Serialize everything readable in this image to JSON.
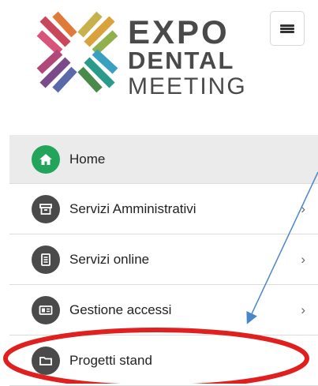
{
  "logo": {
    "line1": "EXPO",
    "line2": "DENTAL",
    "line3": "MEETING"
  },
  "menu_button": {
    "icon": "hamburger-menu-icon"
  },
  "menu": {
    "items": [
      {
        "label": "Home",
        "icon": "home-icon",
        "has_submenu": false,
        "active": true
      },
      {
        "label": "Servizi Amministrativi",
        "icon": "archive-box-icon",
        "has_submenu": true,
        "chevron": "›"
      },
      {
        "label": "Servizi online",
        "icon": "document-icon",
        "has_submenu": true,
        "chevron": "›"
      },
      {
        "label": "Gestione accessi",
        "icon": "id-card-icon",
        "has_submenu": true,
        "chevron": "›"
      },
      {
        "label": "Progetti stand",
        "icon": "folder-icon",
        "has_submenu": false
      }
    ]
  },
  "colors": {
    "home_icon": "#22a45a",
    "icon_bg": "#4a4a4a",
    "active_bg": "#ebebeb",
    "annotation_arrow": "#4a86c8",
    "annotation_ellipse": "#e0201f"
  }
}
